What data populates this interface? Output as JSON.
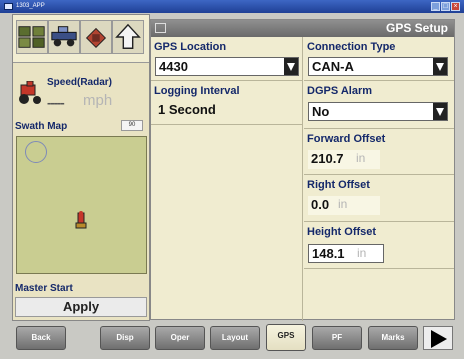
{
  "window": {
    "title": "1303_APP"
  },
  "toolbar": {
    "buttons": [
      {
        "icon": "screens-icon"
      },
      {
        "icon": "vehicle-icon"
      },
      {
        "icon": "implement-icon"
      },
      {
        "icon": "up-arrow-icon"
      }
    ]
  },
  "speed": {
    "label": "Speed(Radar)",
    "value": "-----",
    "unit": "mph",
    "icon": "tractor-icon"
  },
  "swath": {
    "label": "Swath Map",
    "badge": "90"
  },
  "master": {
    "label": "Master Start",
    "button": "Apply"
  },
  "panel": {
    "title": "GPS Setup",
    "gps_location": {
      "label": "GPS Location",
      "value": "4430"
    },
    "connection_type": {
      "label": "Connection Type",
      "value": "CAN-A"
    },
    "logging_interval": {
      "label": "Logging Interval",
      "value": "1 Second"
    },
    "dgps_alarm": {
      "label": "DGPS Alarm",
      "value": "No"
    },
    "forward_offset": {
      "label": "Forward Offset",
      "value": "210.7",
      "unit": "in"
    },
    "right_offset": {
      "label": "Right Offset",
      "value": "0.0",
      "unit": "in"
    },
    "height_offset": {
      "label": "Height Offset",
      "value": "148.1",
      "unit": "in"
    }
  },
  "tabs": [
    {
      "label": "Back"
    },
    {
      "label": "Disp"
    },
    {
      "label": "Oper"
    },
    {
      "label": "Layout"
    },
    {
      "label": "GPS",
      "active": true
    },
    {
      "label": "PF"
    },
    {
      "label": "Marks"
    }
  ],
  "colors": {
    "label_blue": "#14286a",
    "panel_bg": "#f0ecd0",
    "map_bg": "#c9cd91"
  }
}
